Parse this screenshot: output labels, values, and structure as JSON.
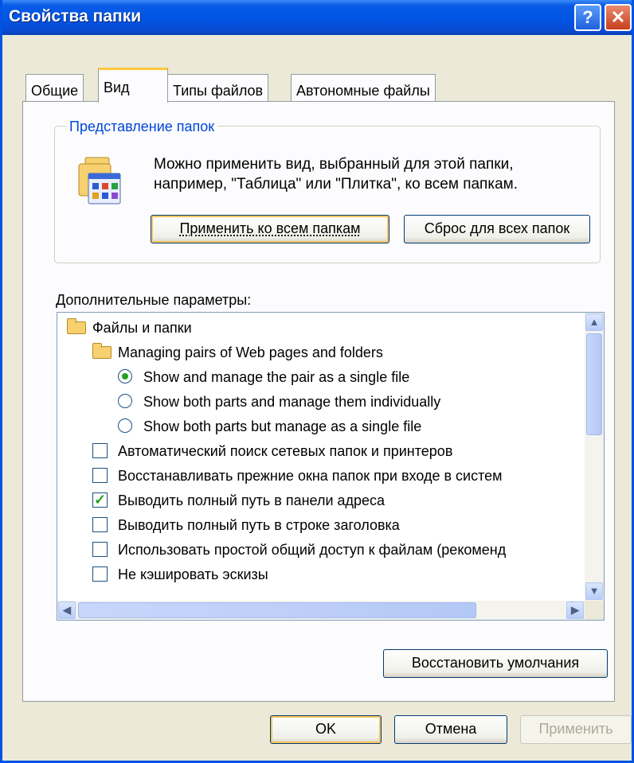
{
  "window": {
    "title": "Свойства папки"
  },
  "tabs": [
    {
      "label": "Общие"
    },
    {
      "label": "Вид"
    },
    {
      "label": "Типы файлов"
    },
    {
      "label": "Автономные файлы"
    }
  ],
  "folder_views": {
    "legend": "Представление папок",
    "description_line1": "Можно применить вид, выбранный для этой папки,",
    "description_line2": "например, \"Таблица\" или \"Плитка\", ко всем папкам.",
    "apply_all_label": "Применить ко всем папкам",
    "reset_all_label": "Сброс для всех папок"
  },
  "advanced": {
    "label": "Дополнительные параметры:",
    "items": [
      {
        "label": "Файлы и папки",
        "kind": "folder",
        "level": 0
      },
      {
        "label": "Managing pairs of Web pages and folders",
        "kind": "folder",
        "level": 1
      },
      {
        "label": "Show and manage the pair as a single file",
        "kind": "radio",
        "checked": true,
        "level": 2
      },
      {
        "label": "Show both parts and manage them individually",
        "kind": "radio",
        "checked": false,
        "level": 2
      },
      {
        "label": "Show both parts but manage as a single file",
        "kind": "radio",
        "checked": false,
        "level": 2
      },
      {
        "label": "Автоматический поиск сетевых папок и принтеров",
        "kind": "checkbox",
        "checked": false,
        "level": 1
      },
      {
        "label": "Восстанавливать прежние окна папок при входе в систем",
        "kind": "checkbox",
        "checked": false,
        "level": 1
      },
      {
        "label": "Выводить полный путь в панели адреса",
        "kind": "checkbox",
        "checked": true,
        "level": 1
      },
      {
        "label": "Выводить полный путь в строке заголовка",
        "kind": "checkbox",
        "checked": false,
        "level": 1
      },
      {
        "label": "Использовать простой общий доступ к файлам (рекоменд",
        "kind": "checkbox",
        "checked": false,
        "level": 1
      },
      {
        "label": "Не кэшировать эскизы",
        "kind": "checkbox",
        "checked": false,
        "level": 1
      }
    ]
  },
  "restore_defaults_label": "Восстановить умолчания",
  "footer": {
    "ok_label": "OK",
    "cancel_label": "Отмена",
    "apply_label": "Применить"
  },
  "icons": {
    "help": "help-icon",
    "close": "close-icon",
    "folder_view": "folder-view-icon",
    "folder": "folder-icon",
    "scroll_up": "scroll-up-icon",
    "scroll_down": "scroll-down-icon",
    "scroll_left": "scroll-left-icon",
    "scroll_right": "scroll-right-icon"
  },
  "colors": {
    "titlebar": "#0054e3",
    "window_bg": "#ece9d8",
    "group_legend": "#0046d5",
    "active_tab_accent": "#ffc83c",
    "check_mark": "#21a121"
  }
}
